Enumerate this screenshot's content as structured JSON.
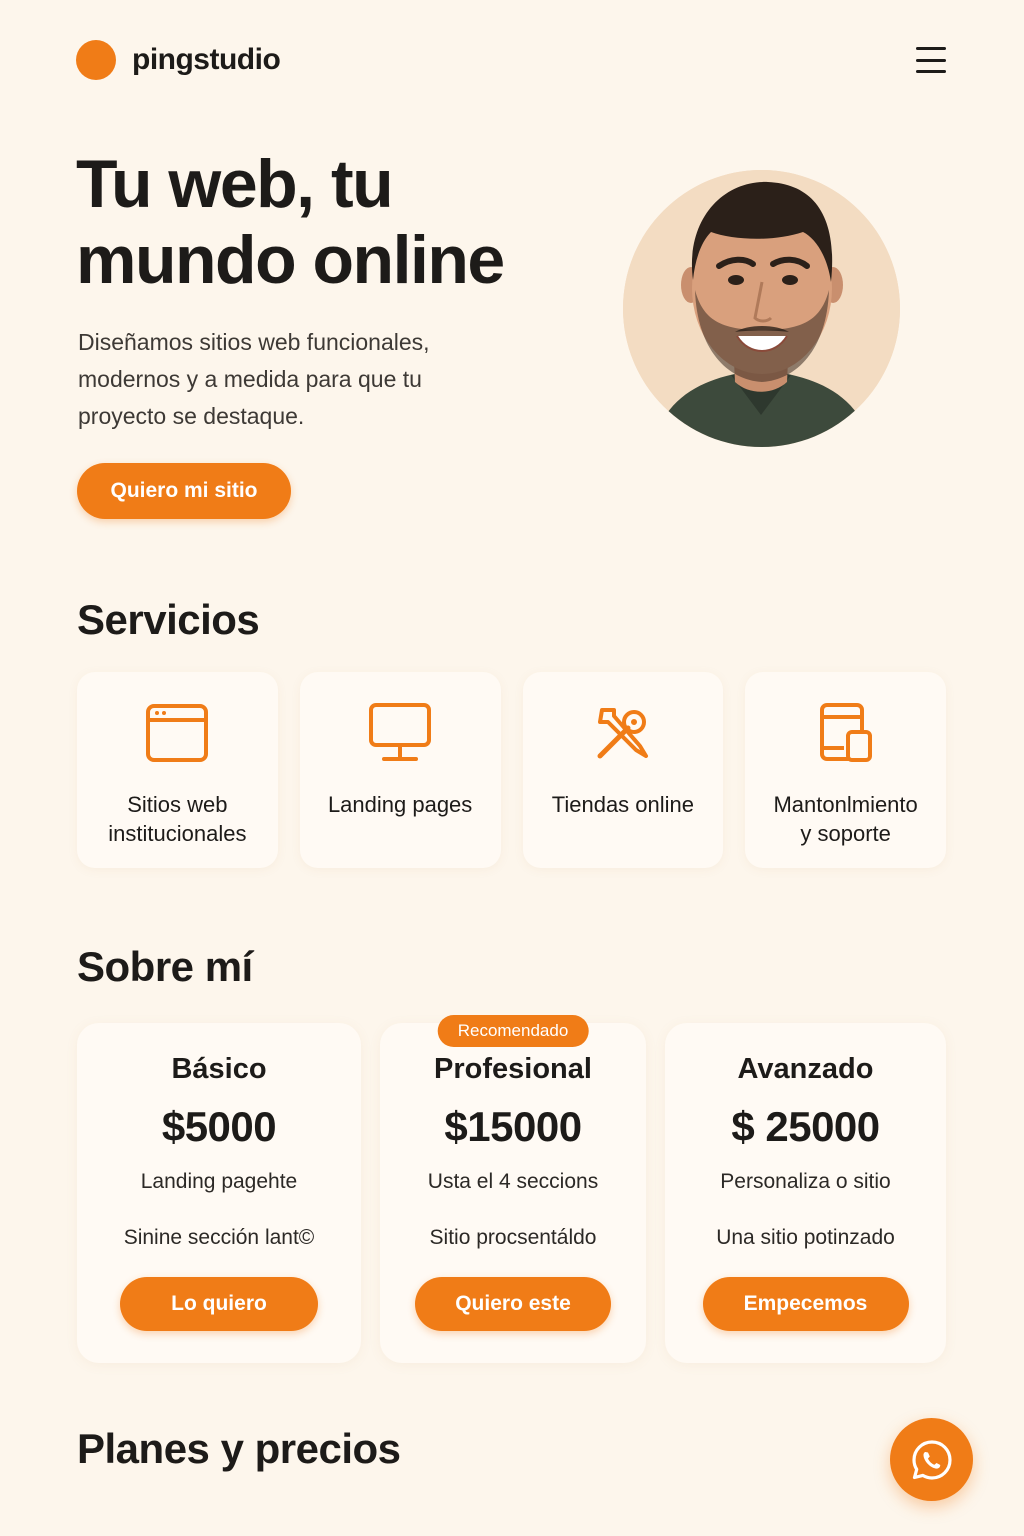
{
  "brand": {
    "name": "pingstudio"
  },
  "header": {
    "menu_icon": "hamburger-menu-icon"
  },
  "hero": {
    "title_line1": "Tu web, tu",
    "title_line2": "mundo online",
    "subtitle_line1": "Diseñamos sitios web funcionales,",
    "subtitle_line2": "modernos y a medida para que tu",
    "subtitle_line3": "proyecto se destaque.",
    "cta": "Quiero mi sitio"
  },
  "services": {
    "title": "Servicios",
    "items": [
      {
        "line1": "Sitios web",
        "line2": "institucionales",
        "icon": "browser-window-icon"
      },
      {
        "line1": "Landing pages",
        "line2": "",
        "icon": "monitor-icon"
      },
      {
        "line1": "Tiendas online",
        "line2": "",
        "icon": "tools-icon"
      },
      {
        "line1": "Mantonlmiento",
        "line2": "y soporte",
        "icon": "devices-icon"
      }
    ]
  },
  "about": {
    "title": "Sobre mí"
  },
  "plans": {
    "items": [
      {
        "name": "Básico",
        "price": "$5000",
        "feature1": "Landing pagehte",
        "feature2": "Sinine sección lant©",
        "button": "Lo quiero"
      },
      {
        "badge": "Recomendado",
        "name": "Profesional",
        "price": "$15000",
        "feature1": "Usta el 4 seccions",
        "feature2": "Sitio procsentáldo",
        "button": "Quiero este"
      },
      {
        "name": "Avanzado",
        "price": "$ 25000",
        "feature1": "Personaliza o sitio",
        "feature2": "Una sitio potinzado",
        "button": "Empecemos"
      }
    ]
  },
  "pricing": {
    "title": "Planes y precios"
  },
  "whatsapp": {
    "icon": "whatsapp-icon"
  },
  "colors": {
    "accent": "#f07c17",
    "background": "#fdf6ec",
    "card": "#fffaf4",
    "text": "#1d1b19"
  }
}
